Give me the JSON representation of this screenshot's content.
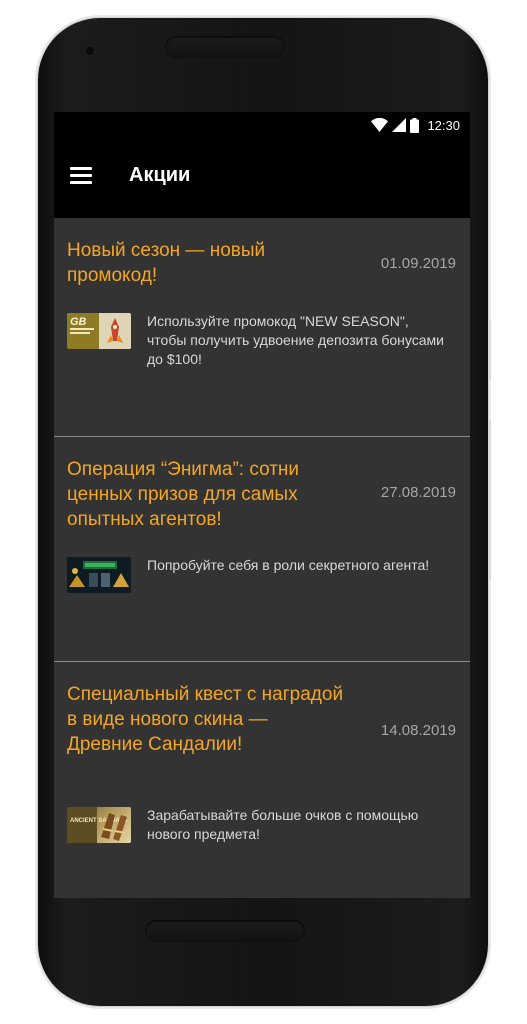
{
  "status_bar": {
    "time": "12:30"
  },
  "app_bar": {
    "title": "Акции"
  },
  "promotions": [
    {
      "title": "Новый сезон — новый промокод!",
      "date": "01.09.2019",
      "description": "Используйте промокод \"NEW SEASON\", чтобы получить удвоение депозита бонусами до $100!",
      "thumb_text": "GB"
    },
    {
      "title": "Операция “Энигма”: сотни ценных призов для самых опытных агентов!",
      "date": "27.08.2019",
      "description": "Попробуйте себя в роли секретного агента!",
      "thumb_text": ""
    },
    {
      "title": "Специальный квест с наградой в виде нового скина — Древние Сандалии!",
      "date": "14.08.2019",
      "description": "Зарабатывайте больше очков с помощью нового предмета!",
      "thumb_text": "ANCIENT SANDALS"
    }
  ],
  "colors": {
    "accent": "#f5a623",
    "background": "#333333",
    "app_bar": "#000000",
    "date": "#a6a6a6",
    "text": "#d8d8d8"
  }
}
